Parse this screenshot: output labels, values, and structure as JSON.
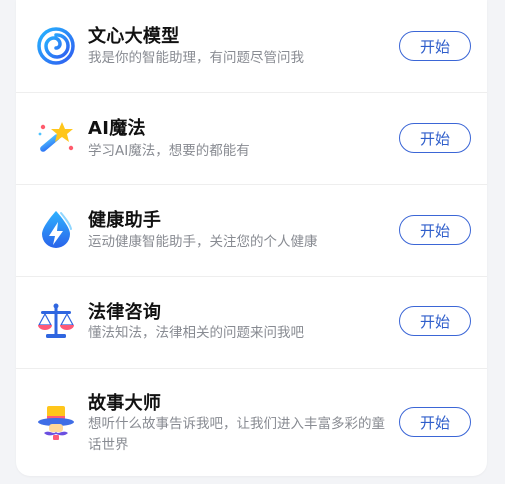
{
  "items": [
    {
      "icon": "wenxin-spiral-icon",
      "title": "文心大模型",
      "desc": "我是你的智能助理，有问题尽管问我",
      "button": "开始"
    },
    {
      "icon": "magic-wand-icon",
      "title": "AI魔法",
      "desc": "学习AI魔法，想要的都能有",
      "button": "开始"
    },
    {
      "icon": "health-drop-lightning-icon",
      "title": "健康助手",
      "desc": "运动健康智能助手，关注您的个人健康",
      "button": "开始"
    },
    {
      "icon": "law-scales-icon",
      "title": "法律咨询",
      "desc": "懂法知法，法律相关的问题来问我吧",
      "button": "开始"
    },
    {
      "icon": "storyteller-hat-icon",
      "title": "故事大师",
      "desc": "想听什么故事告诉我吧，让我们进入丰富多彩的童话世界",
      "button": "开始"
    }
  ]
}
